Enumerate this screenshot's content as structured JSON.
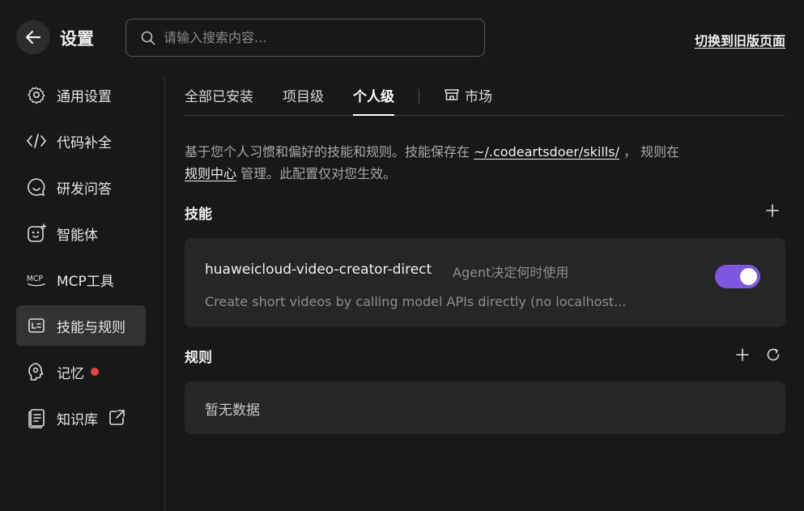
{
  "header": {
    "title": "设置",
    "search_placeholder": "请输入搜索内容...",
    "switch_link": "切换到旧版页面"
  },
  "sidebar": {
    "items": [
      {
        "label": "通用设置",
        "icon": "gear-icon"
      },
      {
        "label": "代码补全",
        "icon": "code-icon"
      },
      {
        "label": "研发问答",
        "icon": "chat-icon"
      },
      {
        "label": "智能体",
        "icon": "agent-icon"
      },
      {
        "label": "MCP工具",
        "icon": "mcp-icon"
      },
      {
        "label": "技能与规则",
        "icon": "skills-icon",
        "active": true
      },
      {
        "label": "记忆",
        "icon": "memory-icon",
        "badge": "red-dot"
      },
      {
        "label": "知识库",
        "icon": "knowledge-icon",
        "external": "external-link-icon"
      }
    ]
  },
  "tabs": {
    "items": [
      "全部已安装",
      "项目级",
      "个人级"
    ],
    "active": "个人级",
    "market": "市场"
  },
  "description": {
    "part1": "基于您个人习惯和偏好的技能和规则。技能保存在 ",
    "skills_path": "~/.codeartsdoer/skills/",
    "part2": " ， 规则在",
    "rules_link": "规则中心",
    "part3": " 管理。此配置仅对您生效。"
  },
  "skills": {
    "title": "技能",
    "items": [
      {
        "name": "huaweicloud-video-creator-direct",
        "mode": "Agent决定何时使用",
        "description": "Create short videos by calling model APIs directly (no localhost...",
        "enabled": true
      }
    ]
  },
  "rules": {
    "title": "规则",
    "empty": "暂无数据"
  },
  "colors": {
    "background": "#181818",
    "card": "#262626",
    "toggle_on": "#7f56e0",
    "badge": "#e5443f"
  }
}
